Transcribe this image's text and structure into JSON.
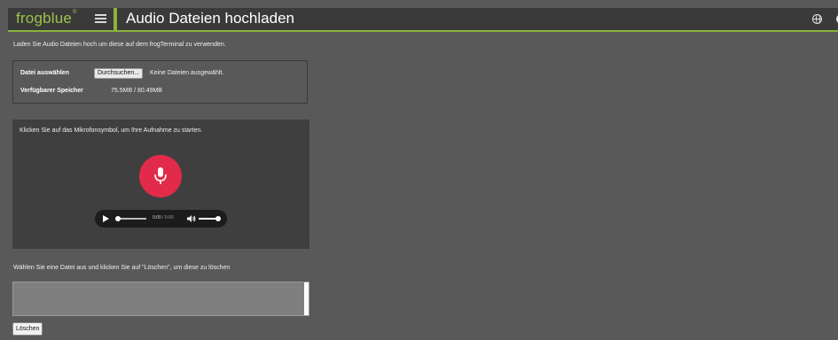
{
  "header": {
    "logo_text": "frogblue",
    "logo_mark": "®",
    "title": "Audio Dateien hochladen",
    "icons": [
      "menu-icon",
      "globe-icon",
      "settings-icon"
    ],
    "accent_color": "#8cb33a"
  },
  "intro_text": "Laden Sie Audio Dateien hoch um diese auf dem frogTerminal zu verwenden.",
  "file_select": {
    "label": "Datei auswählen",
    "browse_label": "Durchsuchen...",
    "status": "Keine Dateien ausgewählt.",
    "storage_label": "Verfügbarer Speicher",
    "storage_value": "75.5MB / 80.49MB"
  },
  "recorder": {
    "hint": "Klicken Sie auf das Mikrofonsymbol, um Ihre Aufnahme zu starten.",
    "mic_color": "#e22b4a",
    "player": {
      "current_time": "0:00",
      "separator": "/",
      "duration": "0:00",
      "progress": 0,
      "volume": 1
    }
  },
  "delete_section": {
    "hint": "Wählen Sie eine Datei aus und klicken Sie auf \"Löschen\", um diese zu löschen",
    "button_label": "Löschen"
  }
}
